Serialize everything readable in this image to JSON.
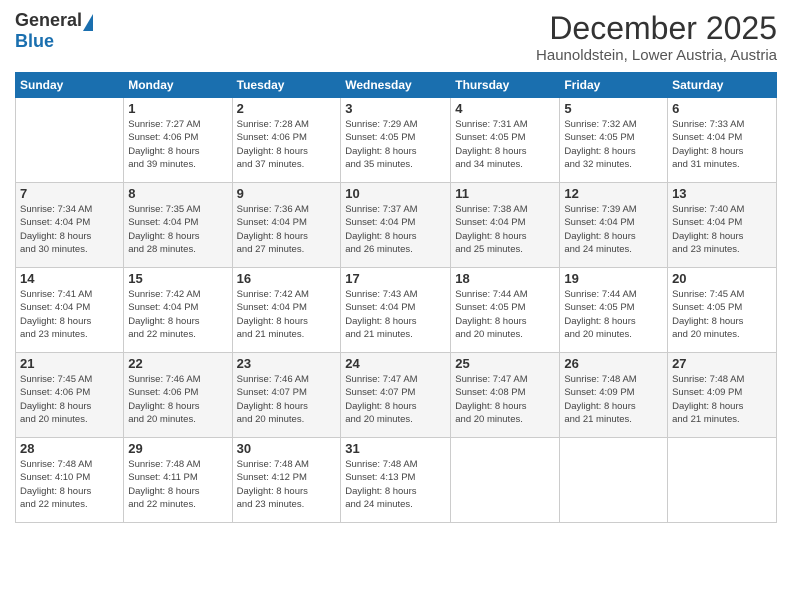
{
  "header": {
    "logo_general": "General",
    "logo_blue": "Blue",
    "month_title": "December 2025",
    "location": "Haunoldstein, Lower Austria, Austria"
  },
  "days_of_week": [
    "Sunday",
    "Monday",
    "Tuesday",
    "Wednesday",
    "Thursday",
    "Friday",
    "Saturday"
  ],
  "weeks": [
    [
      {
        "day": "",
        "info": ""
      },
      {
        "day": "1",
        "info": "Sunrise: 7:27 AM\nSunset: 4:06 PM\nDaylight: 8 hours\nand 39 minutes."
      },
      {
        "day": "2",
        "info": "Sunrise: 7:28 AM\nSunset: 4:06 PM\nDaylight: 8 hours\nand 37 minutes."
      },
      {
        "day": "3",
        "info": "Sunrise: 7:29 AM\nSunset: 4:05 PM\nDaylight: 8 hours\nand 35 minutes."
      },
      {
        "day": "4",
        "info": "Sunrise: 7:31 AM\nSunset: 4:05 PM\nDaylight: 8 hours\nand 34 minutes."
      },
      {
        "day": "5",
        "info": "Sunrise: 7:32 AM\nSunset: 4:05 PM\nDaylight: 8 hours\nand 32 minutes."
      },
      {
        "day": "6",
        "info": "Sunrise: 7:33 AM\nSunset: 4:04 PM\nDaylight: 8 hours\nand 31 minutes."
      }
    ],
    [
      {
        "day": "7",
        "info": "Sunrise: 7:34 AM\nSunset: 4:04 PM\nDaylight: 8 hours\nand 30 minutes."
      },
      {
        "day": "8",
        "info": "Sunrise: 7:35 AM\nSunset: 4:04 PM\nDaylight: 8 hours\nand 28 minutes."
      },
      {
        "day": "9",
        "info": "Sunrise: 7:36 AM\nSunset: 4:04 PM\nDaylight: 8 hours\nand 27 minutes."
      },
      {
        "day": "10",
        "info": "Sunrise: 7:37 AM\nSunset: 4:04 PM\nDaylight: 8 hours\nand 26 minutes."
      },
      {
        "day": "11",
        "info": "Sunrise: 7:38 AM\nSunset: 4:04 PM\nDaylight: 8 hours\nand 25 minutes."
      },
      {
        "day": "12",
        "info": "Sunrise: 7:39 AM\nSunset: 4:04 PM\nDaylight: 8 hours\nand 24 minutes."
      },
      {
        "day": "13",
        "info": "Sunrise: 7:40 AM\nSunset: 4:04 PM\nDaylight: 8 hours\nand 23 minutes."
      }
    ],
    [
      {
        "day": "14",
        "info": "Sunrise: 7:41 AM\nSunset: 4:04 PM\nDaylight: 8 hours\nand 23 minutes."
      },
      {
        "day": "15",
        "info": "Sunrise: 7:42 AM\nSunset: 4:04 PM\nDaylight: 8 hours\nand 22 minutes."
      },
      {
        "day": "16",
        "info": "Sunrise: 7:42 AM\nSunset: 4:04 PM\nDaylight: 8 hours\nand 21 minutes."
      },
      {
        "day": "17",
        "info": "Sunrise: 7:43 AM\nSunset: 4:04 PM\nDaylight: 8 hours\nand 21 minutes."
      },
      {
        "day": "18",
        "info": "Sunrise: 7:44 AM\nSunset: 4:05 PM\nDaylight: 8 hours\nand 20 minutes."
      },
      {
        "day": "19",
        "info": "Sunrise: 7:44 AM\nSunset: 4:05 PM\nDaylight: 8 hours\nand 20 minutes."
      },
      {
        "day": "20",
        "info": "Sunrise: 7:45 AM\nSunset: 4:05 PM\nDaylight: 8 hours\nand 20 minutes."
      }
    ],
    [
      {
        "day": "21",
        "info": "Sunrise: 7:45 AM\nSunset: 4:06 PM\nDaylight: 8 hours\nand 20 minutes."
      },
      {
        "day": "22",
        "info": "Sunrise: 7:46 AM\nSunset: 4:06 PM\nDaylight: 8 hours\nand 20 minutes."
      },
      {
        "day": "23",
        "info": "Sunrise: 7:46 AM\nSunset: 4:07 PM\nDaylight: 8 hours\nand 20 minutes."
      },
      {
        "day": "24",
        "info": "Sunrise: 7:47 AM\nSunset: 4:07 PM\nDaylight: 8 hours\nand 20 minutes."
      },
      {
        "day": "25",
        "info": "Sunrise: 7:47 AM\nSunset: 4:08 PM\nDaylight: 8 hours\nand 20 minutes."
      },
      {
        "day": "26",
        "info": "Sunrise: 7:48 AM\nSunset: 4:09 PM\nDaylight: 8 hours\nand 21 minutes."
      },
      {
        "day": "27",
        "info": "Sunrise: 7:48 AM\nSunset: 4:09 PM\nDaylight: 8 hours\nand 21 minutes."
      }
    ],
    [
      {
        "day": "28",
        "info": "Sunrise: 7:48 AM\nSunset: 4:10 PM\nDaylight: 8 hours\nand 22 minutes."
      },
      {
        "day": "29",
        "info": "Sunrise: 7:48 AM\nSunset: 4:11 PM\nDaylight: 8 hours\nand 22 minutes."
      },
      {
        "day": "30",
        "info": "Sunrise: 7:48 AM\nSunset: 4:12 PM\nDaylight: 8 hours\nand 23 minutes."
      },
      {
        "day": "31",
        "info": "Sunrise: 7:48 AM\nSunset: 4:13 PM\nDaylight: 8 hours\nand 24 minutes."
      },
      {
        "day": "",
        "info": ""
      },
      {
        "day": "",
        "info": ""
      },
      {
        "day": "",
        "info": ""
      }
    ]
  ]
}
